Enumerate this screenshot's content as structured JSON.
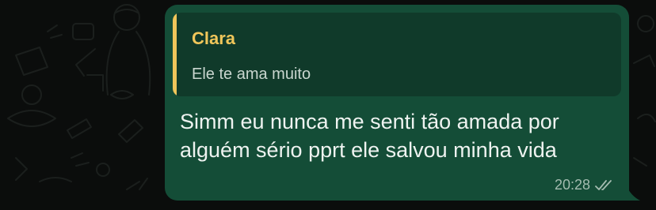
{
  "chat": {
    "wallpaper_color": "#0b0d0c",
    "bubble_color": "#144d37",
    "message": {
      "reply": {
        "author": "Clara",
        "text": "Ele te ama muito",
        "accent_color": "#f0c65a"
      },
      "text": "Simm eu nunca me senti tão amada por alguém sério pprt ele salvou minha vida",
      "time": "20:28",
      "status_icon": "double-check-icon"
    }
  }
}
